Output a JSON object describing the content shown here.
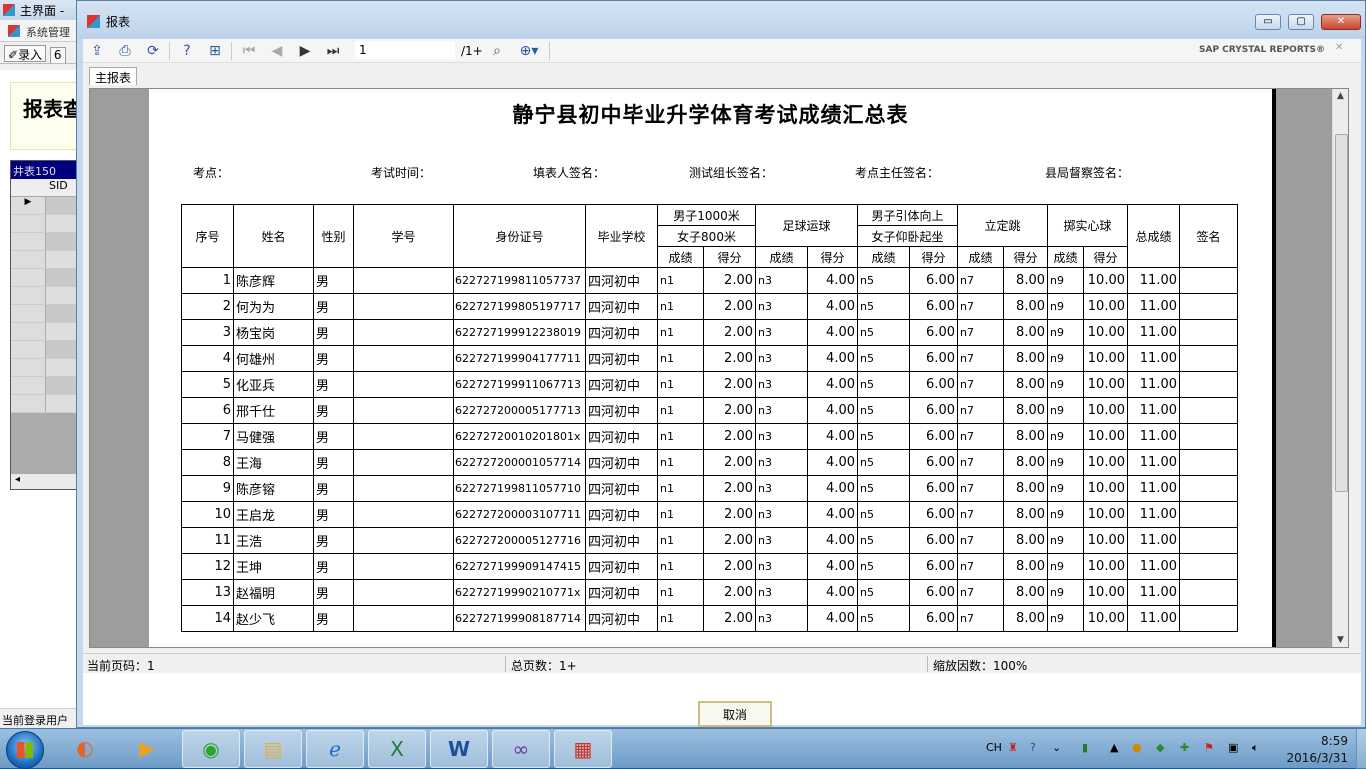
{
  "bg_window": {
    "title": "主界面 -",
    "menu_item": "系统管理",
    "toolbar_btn": "录入",
    "toolbar_btn2": "6",
    "report_title": "报表查",
    "grid_header": "井表150",
    "grid_col": "SID",
    "hscroll_left": "◂",
    "status": "当前登录用户"
  },
  "dialog": {
    "title": "报表",
    "min": "▭",
    "max": "▢",
    "close": "✕"
  },
  "toolbar": {
    "export_icon": "export-icon",
    "print_icon": "print-icon",
    "refresh_icon": "refresh-icon",
    "help_icon": "help-icon",
    "tree_icon": "group-tree-icon",
    "first_icon": "first-page-icon",
    "prev_icon": "prev-page-icon",
    "next_icon": "next-page-icon",
    "last_icon": "last-page-icon",
    "page_value": "1",
    "page_total": "/1+",
    "search_icon": "binoculars-icon",
    "zoom_icon": "zoom-icon",
    "brand": "SAP CRYSTAL REPORTS®",
    "close": "✕"
  },
  "tabs": {
    "main": "主报表"
  },
  "report": {
    "title": "静宁县初中毕业升学体育考试成绩汇总表",
    "signatures": [
      {
        "label": "考点："
      },
      {
        "label": "考试时间："
      },
      {
        "label": "填表人签名："
      },
      {
        "label": "测试组长签名："
      },
      {
        "label": "考点主任签名："
      },
      {
        "label": "县局督察签名："
      }
    ],
    "headers": {
      "seq": "序号",
      "name": "姓名",
      "gender": "性别",
      "student_no": "学号",
      "id_card": "身份证号",
      "school": "毕业学校",
      "run_male": "男子1000米",
      "run_female": "女子800米",
      "football": "足球运球",
      "pull_male": "男子引体向上",
      "situp_female": "女子仰卧起坐",
      "jump": "立定跳",
      "throw": "掷实心球",
      "total": "总成绩",
      "sign": "签名",
      "result": "成绩",
      "score": "得分"
    },
    "rows": [
      {
        "seq": "1",
        "name": "陈彦辉",
        "gender": "男",
        "id": "622727199811057737",
        "school": "四河初中",
        "r1": "n1",
        "s1": "2.00",
        "r2": "n3",
        "s2": "4.00",
        "r3": "n5",
        "s3": "6.00",
        "r4": "n7",
        "s4": "8.00",
        "r5": "n9",
        "s5": "10.00",
        "total": "11.00"
      },
      {
        "seq": "2",
        "name": "何为为",
        "gender": "男",
        "id": "622727199805197717",
        "school": "四河初中",
        "r1": "n1",
        "s1": "2.00",
        "r2": "n3",
        "s2": "4.00",
        "r3": "n5",
        "s3": "6.00",
        "r4": "n7",
        "s4": "8.00",
        "r5": "n9",
        "s5": "10.00",
        "total": "11.00"
      },
      {
        "seq": "3",
        "name": "杨宝岗",
        "gender": "男",
        "id": "622727199912238019",
        "school": "四河初中",
        "r1": "n1",
        "s1": "2.00",
        "r2": "n3",
        "s2": "4.00",
        "r3": "n5",
        "s3": "6.00",
        "r4": "n7",
        "s4": "8.00",
        "r5": "n9",
        "s5": "10.00",
        "total": "11.00"
      },
      {
        "seq": "4",
        "name": "何雄州",
        "gender": "男",
        "id": "622727199904177711",
        "school": "四河初中",
        "r1": "n1",
        "s1": "2.00",
        "r2": "n3",
        "s2": "4.00",
        "r3": "n5",
        "s3": "6.00",
        "r4": "n7",
        "s4": "8.00",
        "r5": "n9",
        "s5": "10.00",
        "total": "11.00"
      },
      {
        "seq": "5",
        "name": "化亚兵",
        "gender": "男",
        "id": "622727199911067713",
        "school": "四河初中",
        "r1": "n1",
        "s1": "2.00",
        "r2": "n3",
        "s2": "4.00",
        "r3": "n5",
        "s3": "6.00",
        "r4": "n7",
        "s4": "8.00",
        "r5": "n9",
        "s5": "10.00",
        "total": "11.00"
      },
      {
        "seq": "6",
        "name": "邢千仕",
        "gender": "男",
        "id": "622727200005177713",
        "school": "四河初中",
        "r1": "n1",
        "s1": "2.00",
        "r2": "n3",
        "s2": "4.00",
        "r3": "n5",
        "s3": "6.00",
        "r4": "n7",
        "s4": "8.00",
        "r5": "n9",
        "s5": "10.00",
        "total": "11.00"
      },
      {
        "seq": "7",
        "name": "马健强",
        "gender": "男",
        "id": "62272720010201801x",
        "school": "四河初中",
        "r1": "n1",
        "s1": "2.00",
        "r2": "n3",
        "s2": "4.00",
        "r3": "n5",
        "s3": "6.00",
        "r4": "n7",
        "s4": "8.00",
        "r5": "n9",
        "s5": "10.00",
        "total": "11.00"
      },
      {
        "seq": "8",
        "name": "王海",
        "gender": "男",
        "id": "622727200001057714",
        "school": "四河初中",
        "r1": "n1",
        "s1": "2.00",
        "r2": "n3",
        "s2": "4.00",
        "r3": "n5",
        "s3": "6.00",
        "r4": "n7",
        "s4": "8.00",
        "r5": "n9",
        "s5": "10.00",
        "total": "11.00"
      },
      {
        "seq": "9",
        "name": "陈彦镕",
        "gender": "男",
        "id": "622727199811057710",
        "school": "四河初中",
        "r1": "n1",
        "s1": "2.00",
        "r2": "n3",
        "s2": "4.00",
        "r3": "n5",
        "s3": "6.00",
        "r4": "n7",
        "s4": "8.00",
        "r5": "n9",
        "s5": "10.00",
        "total": "11.00"
      },
      {
        "seq": "10",
        "name": "王启龙",
        "gender": "男",
        "id": "622727200003107711",
        "school": "四河初中",
        "r1": "n1",
        "s1": "2.00",
        "r2": "n3",
        "s2": "4.00",
        "r3": "n5",
        "s3": "6.00",
        "r4": "n7",
        "s4": "8.00",
        "r5": "n9",
        "s5": "10.00",
        "total": "11.00"
      },
      {
        "seq": "11",
        "name": "王浩",
        "gender": "男",
        "id": "622727200005127716",
        "school": "四河初中",
        "r1": "n1",
        "s1": "2.00",
        "r2": "n3",
        "s2": "4.00",
        "r3": "n5",
        "s3": "6.00",
        "r4": "n7",
        "s4": "8.00",
        "r5": "n9",
        "s5": "10.00",
        "total": "11.00"
      },
      {
        "seq": "12",
        "name": "王坤",
        "gender": "男",
        "id": "622727199909147415",
        "school": "四河初中",
        "r1": "n1",
        "s1": "2.00",
        "r2": "n3",
        "s2": "4.00",
        "r3": "n5",
        "s3": "6.00",
        "r4": "n7",
        "s4": "8.00",
        "r5": "n9",
        "s5": "10.00",
        "total": "11.00"
      },
      {
        "seq": "13",
        "name": "赵福明",
        "gender": "男",
        "id": "62272719990210771x",
        "school": "四河初中",
        "r1": "n1",
        "s1": "2.00",
        "r2": "n3",
        "s2": "4.00",
        "r3": "n5",
        "s3": "6.00",
        "r4": "n7",
        "s4": "8.00",
        "r5": "n9",
        "s5": "10.00",
        "total": "11.00"
      },
      {
        "seq": "14",
        "name": "赵少飞",
        "gender": "男",
        "id": "622727199908187714",
        "school": "四河初中",
        "r1": "n1",
        "s1": "2.00",
        "r2": "n3",
        "s2": "4.00",
        "r3": "n5",
        "s3": "6.00",
        "r4": "n7",
        "s4": "8.00",
        "r5": "n9",
        "s5": "10.00",
        "total": "11.00"
      }
    ]
  },
  "status": {
    "current_page": "当前页码：1",
    "total_pages": "总页数：1+",
    "zoom": "缩放因数：100%"
  },
  "cancel_label": "取消",
  "taskbar": {
    "items": [
      "media-player-icon",
      "browser-icon",
      "explorer-folder-icon",
      "ie-icon",
      "excel-icon",
      "word-icon",
      "visual-studio-icon",
      "app-icon"
    ],
    "tray_lang": "CH",
    "time": "8:59",
    "date": "2016/3/31"
  }
}
